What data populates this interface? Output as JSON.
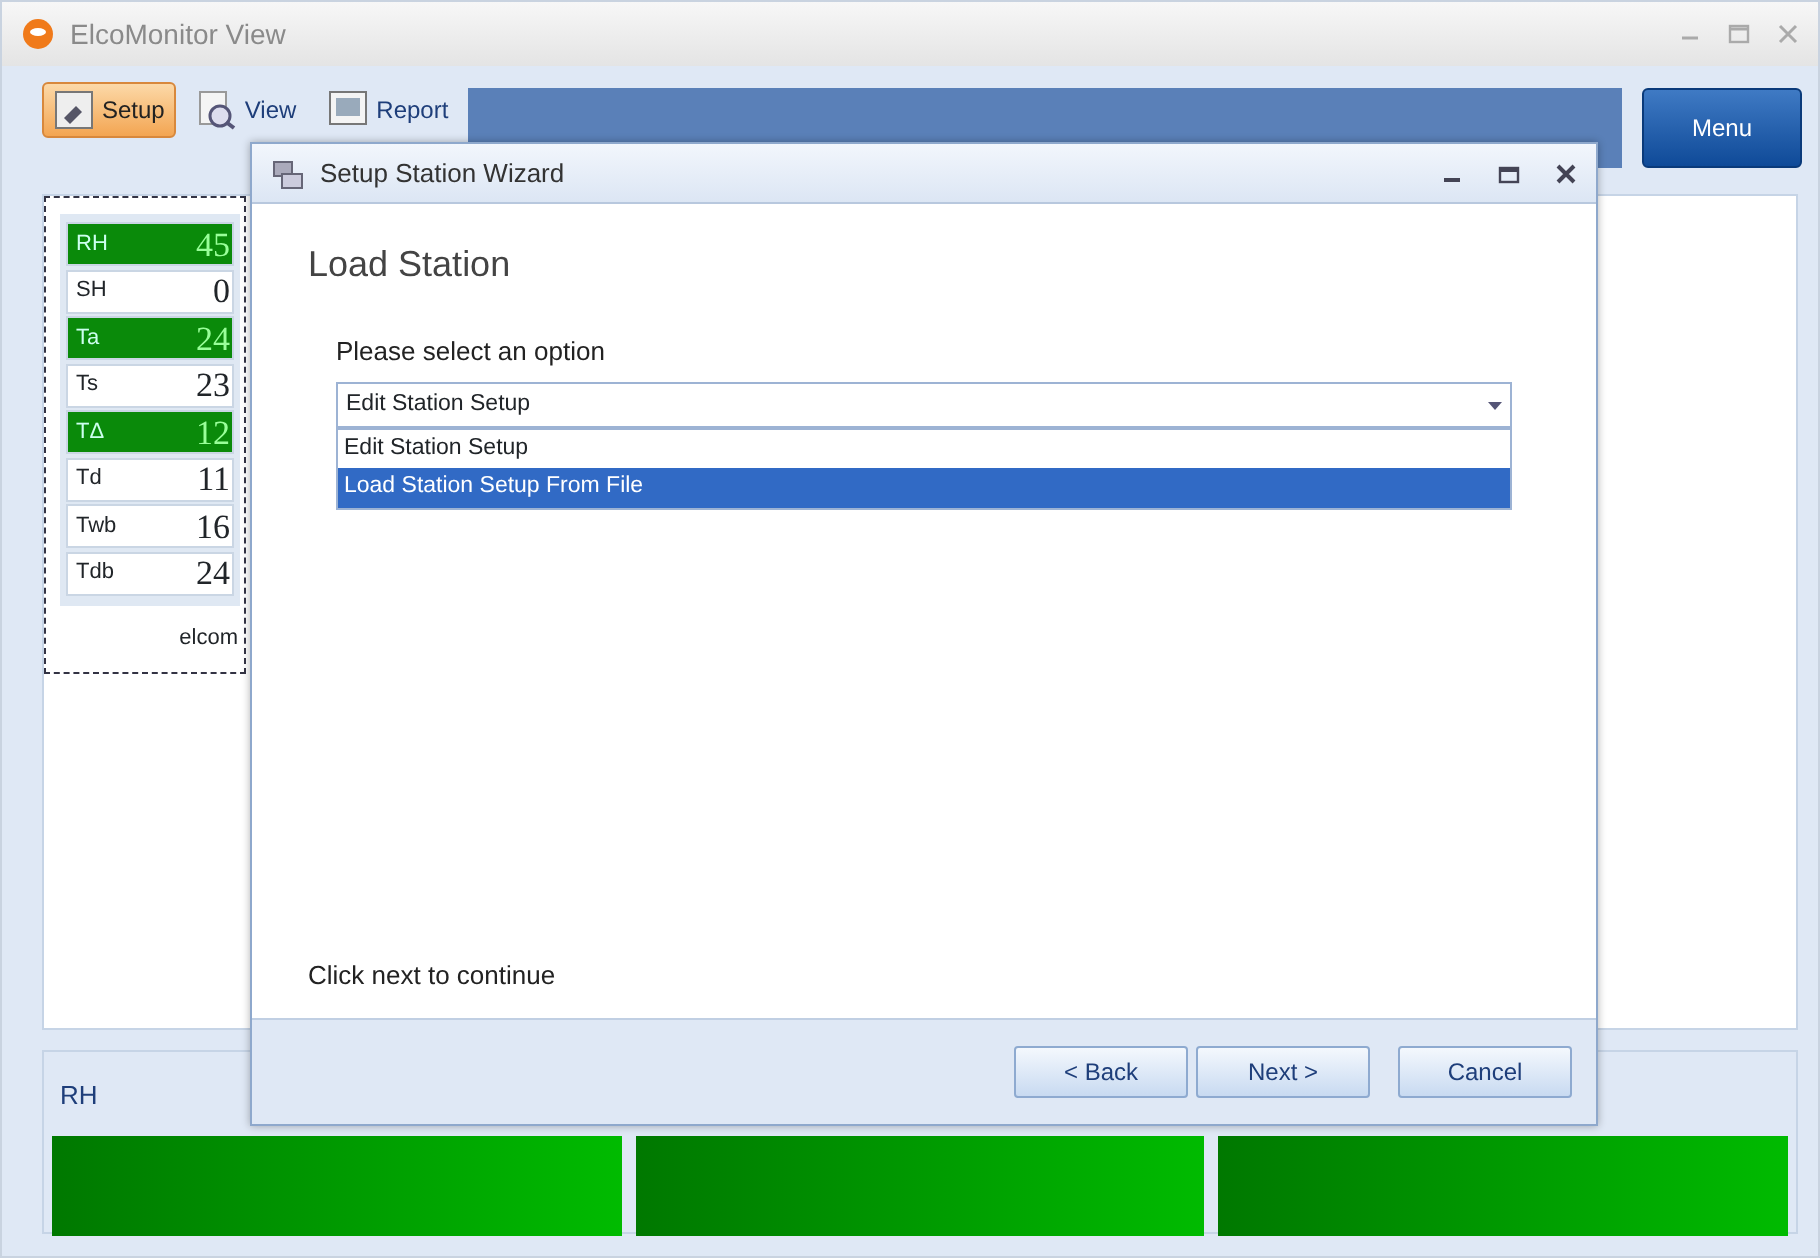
{
  "window": {
    "title": "ElcoMonitor View"
  },
  "toolbar": {
    "tabs": [
      {
        "label": "Setup",
        "selected": true
      },
      {
        "label": "View",
        "selected": false
      },
      {
        "label": "Report",
        "selected": false
      }
    ],
    "menu_button": "Menu"
  },
  "station": {
    "name": "elcom",
    "readings": [
      {
        "label": "RH",
        "value": "45",
        "highlighted": true
      },
      {
        "label": "SH",
        "value": "0",
        "highlighted": false
      },
      {
        "label": "Ta",
        "value": "24",
        "highlighted": true
      },
      {
        "label": "Ts",
        "value": "23",
        "highlighted": false
      },
      {
        "label": "TΔ",
        "value": "12",
        "highlighted": true
      },
      {
        "label": "Td",
        "value": "11",
        "highlighted": false
      },
      {
        "label": "Twb",
        "value": "16",
        "highlighted": false
      },
      {
        "label": "Tdb",
        "value": "24",
        "highlighted": false
      }
    ]
  },
  "bottom_panel": {
    "label": "RH",
    "bars": [
      {
        "level": 1
      },
      {
        "level": 1
      },
      {
        "level": 1
      }
    ]
  },
  "dialog": {
    "title": "Setup Station Wizard",
    "heading": "Load Station",
    "prompt": "Please select an option",
    "combo_value": "Edit Station Setup",
    "options": [
      {
        "label": "Edit Station Setup",
        "selected": false
      },
      {
        "label": "Load Station Setup From File",
        "selected": true
      }
    ],
    "footer_text": "Click next to continue",
    "buttons": [
      "< Back",
      "Next >",
      "Cancel"
    ]
  }
}
